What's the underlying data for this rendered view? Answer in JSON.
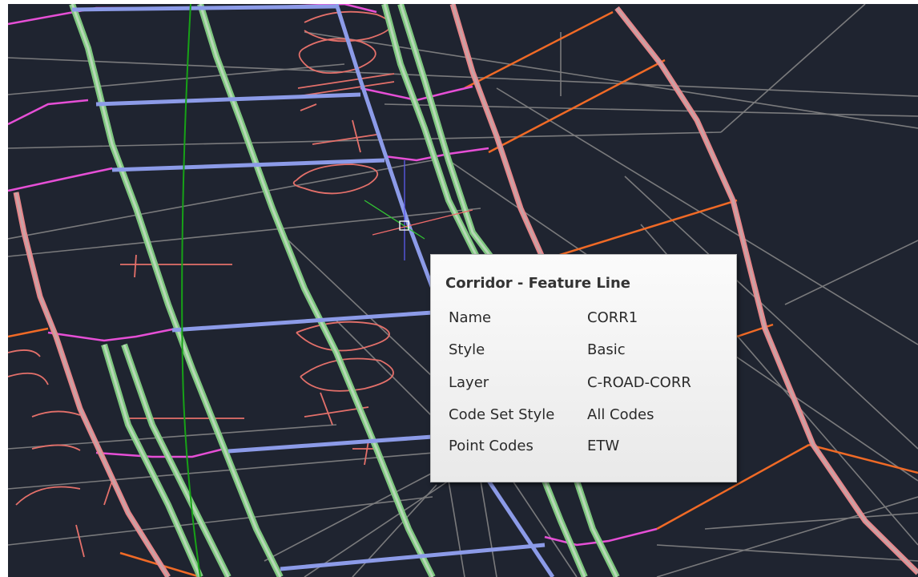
{
  "colors": {
    "background": "#1f2430",
    "gray_line": "#8a8a8a",
    "pink_outline": "#e8868a",
    "pink_fill": "#c9a3a6",
    "green_outline": "#7fc87f",
    "green_fill": "#b8d8b8",
    "blue_fill": "#8c9be8",
    "magenta": "#e64fd6",
    "orange": "#f06a26",
    "salmon_text": "#e4706a",
    "centerline_green": "#17a217"
  },
  "tooltip": {
    "title": "Corridor - Feature Line",
    "rows": [
      {
        "key": "Name",
        "value": "CORR1"
      },
      {
        "key": "Style",
        "value": "Basic"
      },
      {
        "key": "Layer",
        "value": "C-ROAD-CORR"
      },
      {
        "key": "Code Set Style",
        "value": "All Codes"
      },
      {
        "key": "Point Codes",
        "value": "ETW"
      }
    ]
  }
}
